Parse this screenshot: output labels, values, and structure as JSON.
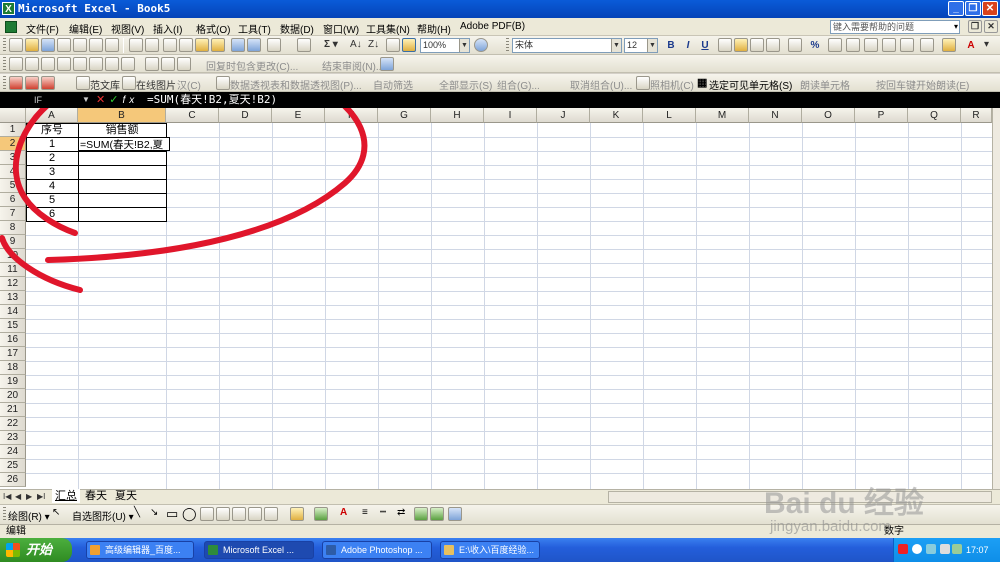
{
  "window": {
    "title": "Microsoft Excel - Book5",
    "controls": [
      "_",
      "❐",
      "✕"
    ],
    "doc_controls": [
      "_",
      "❐",
      "✕"
    ]
  },
  "menu": {
    "items": [
      "文件(F)",
      "编辑(E)",
      "视图(V)",
      "插入(I)",
      "格式(O)",
      "工具(T)",
      "数据(D)",
      "窗口(W)",
      "工具集(N)",
      "帮助(H)",
      "Adobe PDF(B)"
    ],
    "help_placeholder": "键入需要帮助的问题"
  },
  "toolbar_standard": {
    "zoom": "100%",
    "font": "宋体",
    "font_size": "12",
    "format_buttons": [
      "B",
      "I",
      "U",
      "%",
      "A"
    ]
  },
  "toolbar_review": {
    "reply_label": "回复时包含更改(C)...",
    "end_review_label": "结束审阅(N)..."
  },
  "toolbar_addin": {
    "items": [
      "范文库",
      "在线图片",
      "汉(C)",
      "数据透视表和数据透视图(P)...",
      "自动筛选",
      "全部显示(S)",
      "组合(G)...",
      "取消组合(U)...",
      "照相机(C)",
      "选定可见单元格(S)",
      "朗读单元格",
      "按回车键开始朗读(E)"
    ]
  },
  "formula_bar": {
    "name_box": "IF",
    "icons": "✕ ✓ fx",
    "formula": "=SUM(春天!B2,夏天!B2)"
  },
  "grid": {
    "columns": [
      "A",
      "B",
      "C",
      "D",
      "E",
      "F",
      "G",
      "H",
      "I",
      "J",
      "K",
      "L",
      "M",
      "N",
      "O",
      "P",
      "Q",
      "R"
    ],
    "rows": [
      "1",
      "2",
      "3",
      "4",
      "5",
      "6",
      "7",
      "8",
      "9",
      "10",
      "11",
      "12",
      "13",
      "14",
      "15",
      "16",
      "17",
      "18",
      "19",
      "20",
      "21",
      "22",
      "23",
      "24",
      "25",
      "26"
    ],
    "header_a": "序号",
    "header_b": "销售额",
    "seq": [
      "1",
      "2",
      "3",
      "4",
      "5",
      "6"
    ],
    "b2_editing": "=SUM(春天!B2,夏"
  },
  "sheets": {
    "tabs": [
      "汇总",
      "春天",
      "夏天"
    ],
    "nav": [
      "I◀",
      "◀",
      "▶",
      "▶I"
    ]
  },
  "drawbar": {
    "draw_label": "绘图(R) ▾",
    "autoshape_label": "自选图形(U) ▾"
  },
  "status": {
    "mode": "编辑",
    "right": "数字"
  },
  "taskbar": {
    "start": "开始",
    "tasks": [
      "高级编辑器_百度...",
      "Microsoft Excel ...",
      "Adobe Photoshop ...",
      "E:\\收入\\百度经验..."
    ],
    "clock": "17:07"
  },
  "watermark": {
    "logo": "Bai du 经验",
    "url": "jingyan.baidu.com"
  },
  "annotation": {
    "color": "#e0162b"
  }
}
